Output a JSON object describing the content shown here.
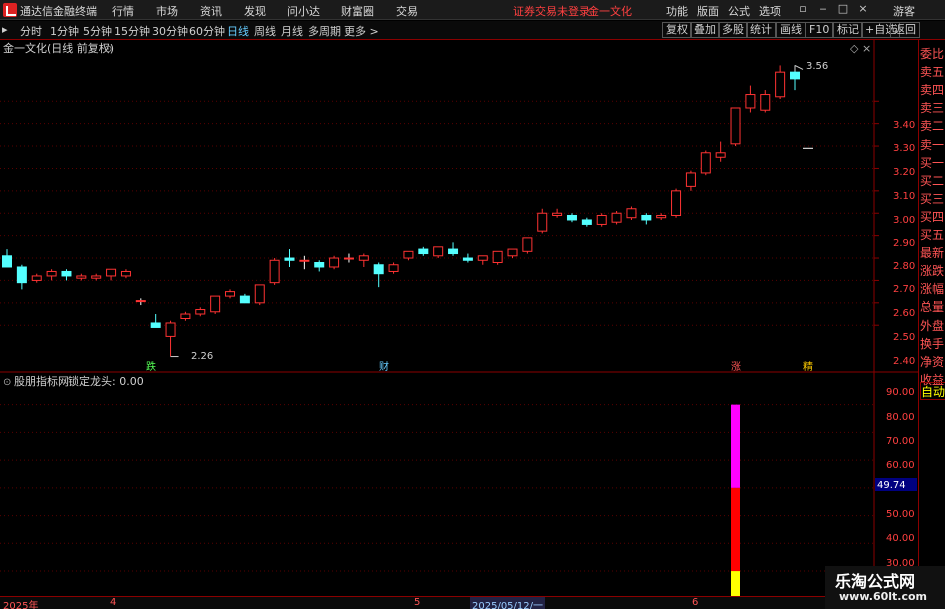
{
  "titlebar": {
    "app_name": "通达信金融终端",
    "menus": [
      "行情",
      "市场",
      "资讯",
      "发现",
      "问小达",
      "财富圈",
      "交易"
    ],
    "status": "证券交易未登录",
    "stock": "金一文化",
    "right": [
      "功能",
      "版面",
      "公式",
      "选项"
    ],
    "user": "游客"
  },
  "toolbar": {
    "periods": [
      "分时",
      "1分钟",
      "5分钟",
      "15分钟",
      "30分钟",
      "60分钟",
      "日线",
      "周线",
      "月线",
      "多周期",
      "更多 >"
    ],
    "active": "日线",
    "buttons": [
      "复权",
      "叠加",
      "多股",
      "统计",
      "画线",
      "F10",
      "标记",
      "+自选",
      "返回"
    ]
  },
  "main_chart": {
    "title": "金一文化(日线 前复权)",
    "y_ticks": [
      "3.40",
      "3.30",
      "3.20",
      "3.10",
      "3.00",
      "2.90",
      "2.80",
      "2.70",
      "2.60",
      "2.50",
      "2.40"
    ],
    "high_label": "3.56",
    "low_label": "2.26",
    "markers": [
      "跌",
      "财",
      "涨",
      "精"
    ]
  },
  "indicator": {
    "name": "股朋指标网",
    "label": "锁定龙头: 0.00",
    "y_ticks": [
      "90.00",
      "80.00",
      "70.00",
      "60.00",
      "50.00",
      "40.00",
      "30.00"
    ],
    "current": "49.74"
  },
  "right_panel": [
    "委比",
    "卖五",
    "卖四",
    "卖三",
    "卖二",
    "卖一",
    "买一",
    "买二",
    "买三",
    "买四",
    "买五",
    "最新",
    "涨跌",
    "涨幅",
    "总量",
    "外盘",
    "换手",
    "净资",
    "收益",
    "自动"
  ],
  "bottom_dates": [
    "2025年",
    "4",
    "5",
    "2025/05/12/一",
    "6"
  ],
  "watermark": {
    "title": "乐淘公式网",
    "url": "www.60lt.com"
  },
  "colors": {
    "up": "#ff3333",
    "down": "#54ffff",
    "magenta": "#ff00ff",
    "red": "#ff0000",
    "yellow": "#ffff00"
  },
  "chart_data": {
    "type": "candlestick",
    "title": "金一文化(日线 前复权)",
    "ylim": [
      2.2,
      3.62
    ],
    "candles": [
      [
        2.71,
        2.74,
        2.67,
        2.66
      ],
      [
        2.66,
        2.67,
        2.56,
        2.59
      ],
      [
        2.6,
        2.63,
        2.59,
        2.62
      ],
      [
        2.62,
        2.65,
        2.6,
        2.64
      ],
      [
        2.64,
        2.65,
        2.6,
        2.62
      ],
      [
        2.61,
        2.63,
        2.6,
        2.62
      ],
      [
        2.61,
        2.63,
        2.6,
        2.62
      ],
      [
        2.62,
        2.64,
        2.6,
        2.65
      ],
      [
        2.62,
        2.65,
        2.61,
        2.64
      ],
      [
        2.51,
        2.52,
        2.49,
        2.51
      ],
      [
        2.41,
        2.45,
        2.39,
        2.39
      ],
      [
        2.35,
        2.42,
        2.26,
        2.41
      ],
      [
        2.43,
        2.46,
        2.42,
        2.45
      ],
      [
        2.45,
        2.48,
        2.44,
        2.47
      ],
      [
        2.46,
        2.53,
        2.45,
        2.53
      ],
      [
        2.53,
        2.56,
        2.52,
        2.55
      ],
      [
        2.53,
        2.54,
        2.5,
        2.5
      ],
      [
        2.5,
        2.58,
        2.49,
        2.58
      ],
      [
        2.59,
        2.7,
        2.58,
        2.69
      ],
      [
        2.7,
        2.74,
        2.66,
        2.69
      ],
      [
        2.69,
        2.71,
        2.65,
        2.69
      ],
      [
        2.68,
        2.69,
        2.64,
        2.66
      ],
      [
        2.66,
        2.71,
        2.65,
        2.7
      ],
      [
        2.7,
        2.72,
        2.68,
        2.7
      ],
      [
        2.69,
        2.72,
        2.66,
        2.71
      ],
      [
        2.67,
        2.68,
        2.57,
        2.63
      ],
      [
        2.64,
        2.68,
        2.63,
        2.67
      ],
      [
        2.7,
        2.73,
        2.69,
        2.73
      ],
      [
        2.74,
        2.75,
        2.71,
        2.72
      ],
      [
        2.71,
        2.75,
        2.7,
        2.75
      ],
      [
        2.74,
        2.77,
        2.71,
        2.72
      ],
      [
        2.7,
        2.72,
        2.68,
        2.69
      ],
      [
        2.69,
        2.7,
        2.67,
        2.71
      ],
      [
        2.68,
        2.73,
        2.67,
        2.73
      ],
      [
        2.71,
        2.74,
        2.7,
        2.74
      ],
      [
        2.73,
        2.79,
        2.72,
        2.79
      ],
      [
        2.82,
        2.92,
        2.81,
        2.9
      ],
      [
        2.89,
        2.92,
        2.88,
        2.9
      ],
      [
        2.89,
        2.9,
        2.86,
        2.87
      ],
      [
        2.87,
        2.88,
        2.84,
        2.85
      ],
      [
        2.85,
        2.9,
        2.84,
        2.89
      ],
      [
        2.86,
        2.91,
        2.85,
        2.9
      ],
      [
        2.88,
        2.93,
        2.87,
        2.92
      ],
      [
        2.89,
        2.9,
        2.85,
        2.87
      ],
      [
        2.88,
        2.9,
        2.87,
        2.89
      ],
      [
        2.89,
        3.01,
        2.88,
        3.0
      ],
      [
        3.02,
        3.09,
        3.0,
        3.08
      ],
      [
        3.08,
        3.18,
        3.07,
        3.17
      ],
      [
        3.15,
        3.22,
        3.13,
        3.17
      ],
      [
        3.21,
        3.37,
        3.2,
        3.37
      ],
      [
        3.37,
        3.47,
        3.35,
        3.43
      ],
      [
        3.36,
        3.45,
        3.35,
        3.43
      ],
      [
        3.42,
        3.56,
        3.41,
        3.53
      ],
      [
        3.53,
        3.56,
        3.45,
        3.5
      ]
    ],
    "indicator": {
      "segments": [
        {
          "from": 0,
          "to": 30,
          "color": "#ffff00"
        },
        {
          "from": 30,
          "to": 60,
          "color": "#ff0000"
        },
        {
          "from": 60,
          "to": 90,
          "color": "#ff00ff"
        }
      ],
      "ylim": [
        21,
        96
      ]
    }
  }
}
